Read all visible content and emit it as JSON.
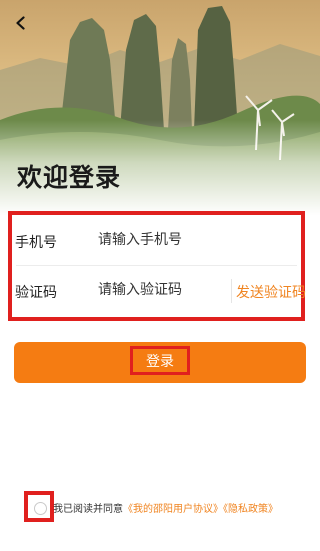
{
  "page": {
    "title": "欢迎登录"
  },
  "form": {
    "phone": {
      "label": "手机号",
      "placeholder": "请输入手机号",
      "value": ""
    },
    "code": {
      "label": "验证码",
      "placeholder": "请输入验证码",
      "value": "",
      "send_label": "发送验证码"
    }
  },
  "login_button": {
    "label": "登录"
  },
  "agreement": {
    "prefix": "我已阅读并同意",
    "user_agreement": "《我的邵阳用户协议》",
    "privacy_policy": "《隐私政策》",
    "checked": false
  },
  "colors": {
    "accent": "#f57c12",
    "link": "#f08522",
    "highlight": "#e0201e"
  },
  "icons": {
    "back": "chevron-left-icon"
  }
}
